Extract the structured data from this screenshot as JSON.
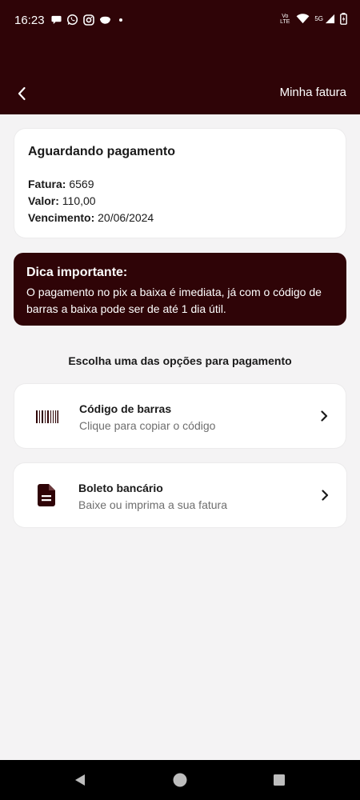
{
  "status_bar": {
    "time": "16:23",
    "left_icons": [
      "chat-bubble-icon",
      "whatsapp-icon",
      "instagram-icon",
      "bowl-icon",
      "dot-icon"
    ],
    "volte": "Vo LTE",
    "network": "5G",
    "right_icons": [
      "volte-icon",
      "wifi-icon",
      "signal-icon",
      "battery-icon"
    ]
  },
  "header": {
    "title": "Minha fatura",
    "back_icon": "chevron-left-icon",
    "background": "#2f0407"
  },
  "status_card": {
    "title": "Aguardando pagamento",
    "fatura_label": "Fatura:",
    "fatura_value": "6569",
    "valor_label": "Valor:",
    "valor_value": "110,00",
    "vencimento_label": "Vencimento:",
    "vencimento_value": "20/06/2024"
  },
  "tip": {
    "title": "Dica importante:",
    "text": "O pagamento no pix a baixa é imediata, já com o código de barras a baixa pode ser de até 1 dia útil."
  },
  "section_title": "Escolha uma das opções para pagamento",
  "options": [
    {
      "title": "Código de barras",
      "subtitle": "Clique para copiar o código",
      "icon": "barcode-icon"
    },
    {
      "title": "Boleto bancário",
      "subtitle": "Baixe ou imprima a sua fatura",
      "icon": "document-icon"
    }
  ],
  "nav_bar": {
    "icons": [
      "nav-back-icon",
      "nav-home-icon",
      "nav-recents-icon"
    ]
  },
  "colors": {
    "brand": "#2f0407",
    "background": "#f4f3f4",
    "card": "#ffffff",
    "muted_text": "#6e6e6e"
  }
}
